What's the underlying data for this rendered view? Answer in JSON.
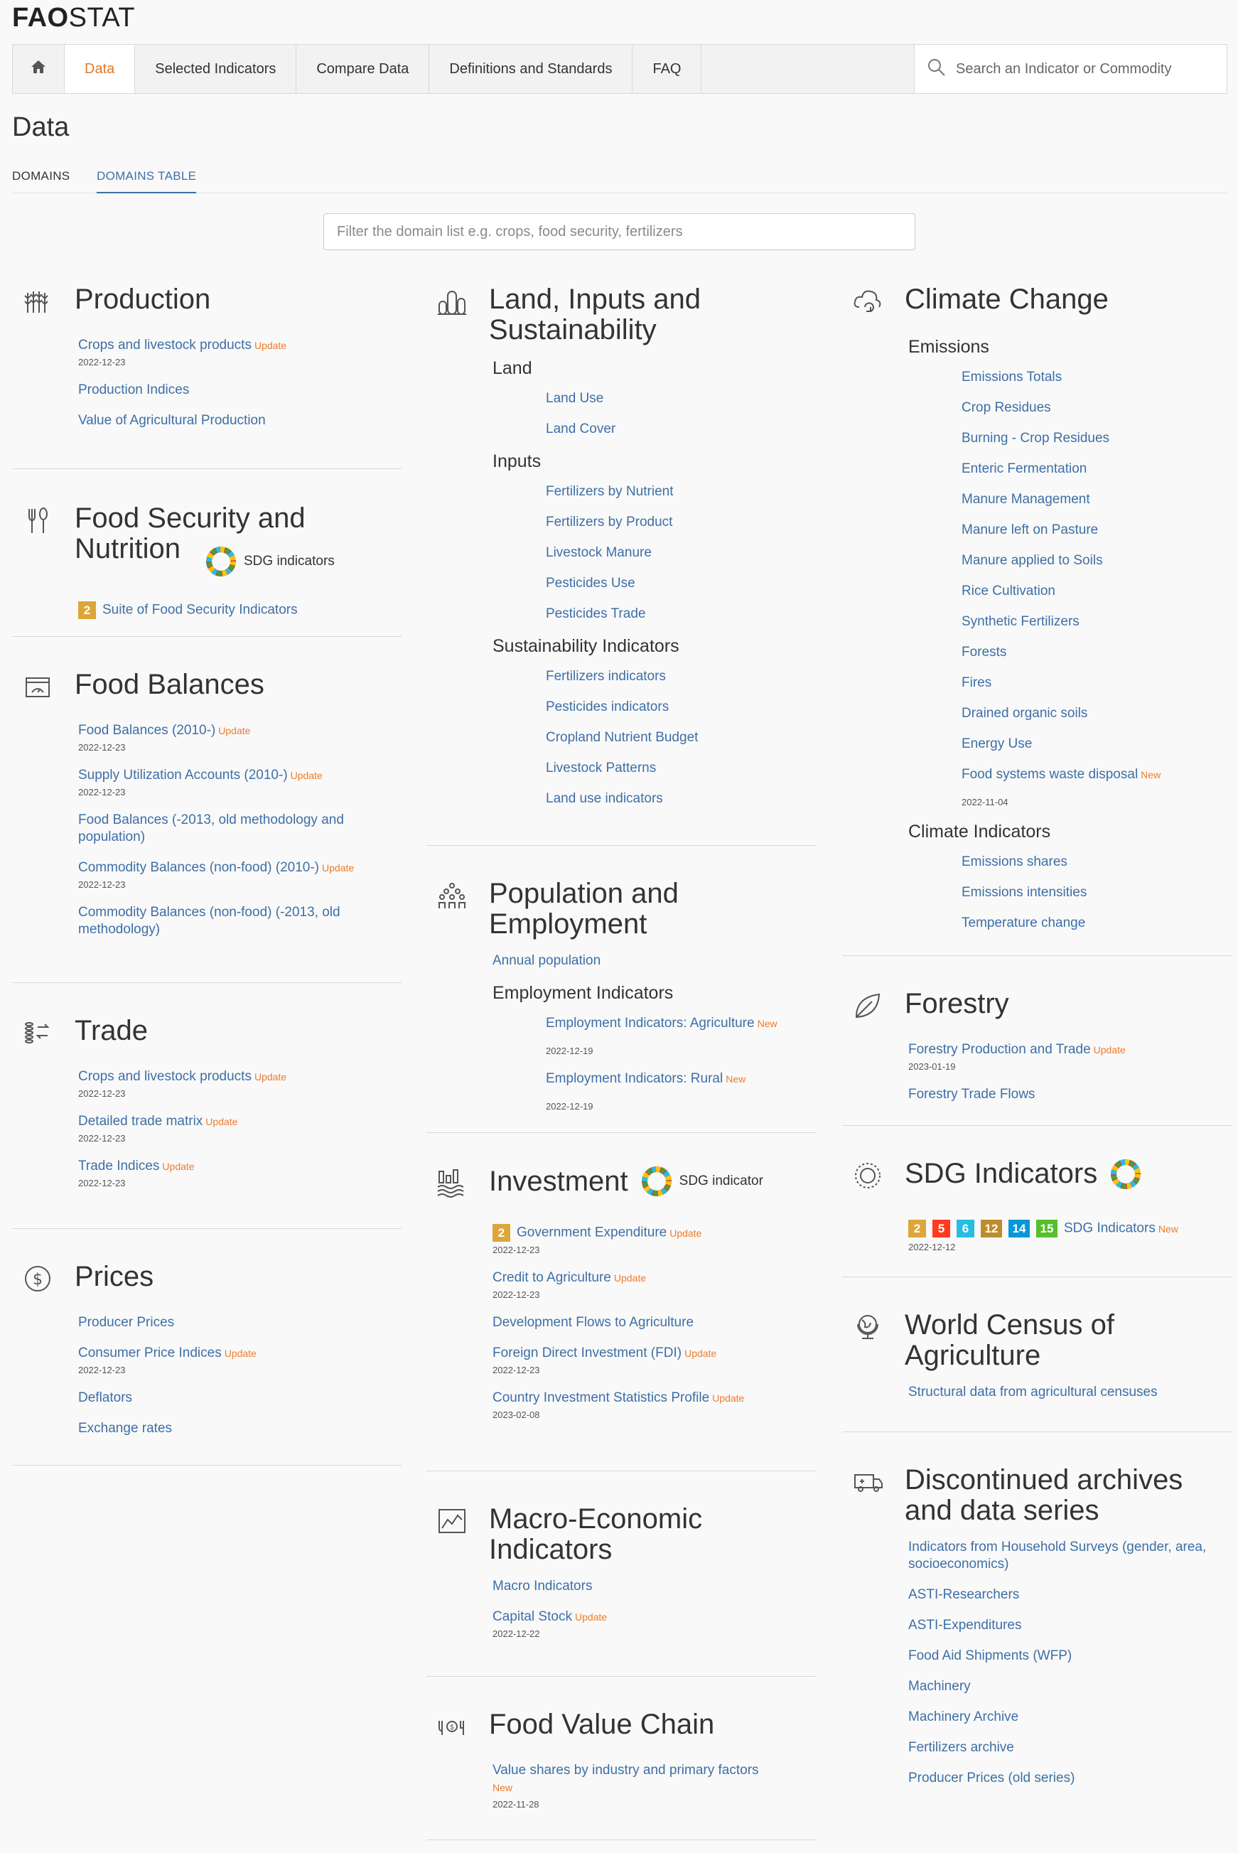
{
  "brand": {
    "bold": "FAO",
    "light": "STAT"
  },
  "nav": {
    "items": [
      "Data",
      "Selected Indicators",
      "Compare Data",
      "Definitions and Standards",
      "FAQ"
    ],
    "search_placeholder": "Search an Indicator or Commodity"
  },
  "page_title": "Data",
  "tabs": [
    "DOMAINS",
    "DOMAINS TABLE"
  ],
  "filter_placeholder": "Filter the domain list e.g. crops, food security, fertilizers",
  "labels": {
    "update": "Update",
    "new": "New",
    "sdg_indicators": "SDG indicators",
    "sdg_indicator": "SDG indicator"
  },
  "production": {
    "title": "Production",
    "crops": "Crops and livestock products",
    "crops_date": "2022-12-23",
    "indices": "Production Indices",
    "value": "Value of Agricultural Production"
  },
  "food_security": {
    "title": "Food Security and Nutrition",
    "suite_num": "2",
    "suite": "Suite of Food Security Indicators"
  },
  "food_balances": {
    "title": "Food Balances",
    "fb2010": "Food Balances (2010-)",
    "fb2010_date": "2022-12-23",
    "sua": "Supply Utilization Accounts (2010-)",
    "sua_date": "2022-12-23",
    "fbold": "Food Balances (-2013, old methodology and population)",
    "cb2010": "Commodity Balances (non-food) (2010-)",
    "cb2010_date": "2022-12-23",
    "cbold": "Commodity Balances (non-food) (-2013, old methodology)"
  },
  "trade": {
    "title": "Trade",
    "crops": "Crops and livestock products",
    "crops_date": "2022-12-23",
    "matrix": "Detailed trade matrix",
    "matrix_date": "2022-12-23",
    "indices": "Trade Indices",
    "indices_date": "2022-12-23"
  },
  "prices": {
    "title": "Prices",
    "producer": "Producer Prices",
    "cpi": "Consumer Price Indices",
    "cpi_date": "2022-12-23",
    "deflators": "Deflators",
    "exchange": "Exchange rates"
  },
  "land": {
    "title": "Land, Inputs and Sustainability",
    "land_sub": "Land",
    "land_items": [
      "Land Use",
      "Land Cover"
    ],
    "inputs_sub": "Inputs",
    "inputs_items": [
      "Fertilizers by Nutrient",
      "Fertilizers by Product",
      "Livestock Manure",
      "Pesticides Use",
      "Pesticides Trade"
    ],
    "sust_sub": "Sustainability Indicators",
    "sust_items": [
      "Fertilizers indicators",
      "Pesticides indicators",
      "Cropland Nutrient Budget",
      "Livestock Patterns",
      "Land use indicators"
    ]
  },
  "population": {
    "title": "Population and Employment",
    "annual": "Annual population",
    "emp_sub": "Employment Indicators",
    "emp_agri": "Employment Indicators: Agriculture",
    "emp_agri_date": "2022-12-19",
    "emp_rural": "Employment Indicators: Rural",
    "emp_rural_date": "2022-12-19"
  },
  "investment": {
    "title": "Investment",
    "gov_num": "2",
    "gov": "Government Expenditure",
    "gov_date": "2022-12-23",
    "credit": "Credit to Agriculture",
    "credit_date": "2022-12-23",
    "dev": "Development Flows to Agriculture",
    "fdi": "Foreign Direct Investment (FDI)",
    "fdi_date": "2022-12-23",
    "country": "Country Investment Statistics Profile",
    "country_date": "2023-02-08"
  },
  "macro": {
    "title": "Macro-Economic Indicators",
    "macro": "Macro Indicators",
    "capital": "Capital Stock",
    "capital_date": "2022-12-22"
  },
  "fvc": {
    "title": "Food Value Chain",
    "value": "Value shares by industry and primary factors",
    "value_date": "2022-11-28"
  },
  "climate": {
    "title": "Climate Change",
    "em_sub": "Emissions",
    "em_items": [
      "Emissions Totals",
      "Crop Residues",
      "Burning - Crop Residues",
      "Enteric Fermentation",
      "Manure Management",
      "Manure left on Pasture",
      "Manure applied to Soils",
      "Rice Cultivation",
      "Synthetic Fertilizers",
      "Forests",
      "Fires",
      "Drained organic soils",
      "Energy Use"
    ],
    "waste": "Food systems waste disposal",
    "waste_date": "2022-11-04",
    "ci_sub": "Climate Indicators",
    "ci_items": [
      "Emissions shares",
      "Emissions intensities",
      "Temperature change"
    ]
  },
  "forestry": {
    "title": "Forestry",
    "prod": "Forestry Production and Trade",
    "prod_date": "2023-01-19",
    "flows": "Forestry Trade Flows"
  },
  "sdg": {
    "title": "SDG Indicators",
    "goals": [
      "2",
      "5",
      "6",
      "12",
      "14",
      "15"
    ],
    "goal_colors": [
      "#dda63a",
      "#ff3a21",
      "#26bde2",
      "#bf8b2e",
      "#0a97d9",
      "#56c02b"
    ],
    "link": "SDG Indicators",
    "date": "2022-12-12"
  },
  "census": {
    "title": "World Census of Agriculture",
    "structural": "Structural data from agricultural censuses"
  },
  "discontinued": {
    "title": "Discontinued archives and data series",
    "items": [
      "Indicators from Household Surveys (gender, area, socioeconomics)",
      "ASTI-Researchers",
      "ASTI-Expenditures",
      "Food Aid Shipments (WFP)",
      "Machinery",
      "Machinery Archive",
      "Fertilizers archive",
      "Producer Prices (old series)"
    ]
  }
}
